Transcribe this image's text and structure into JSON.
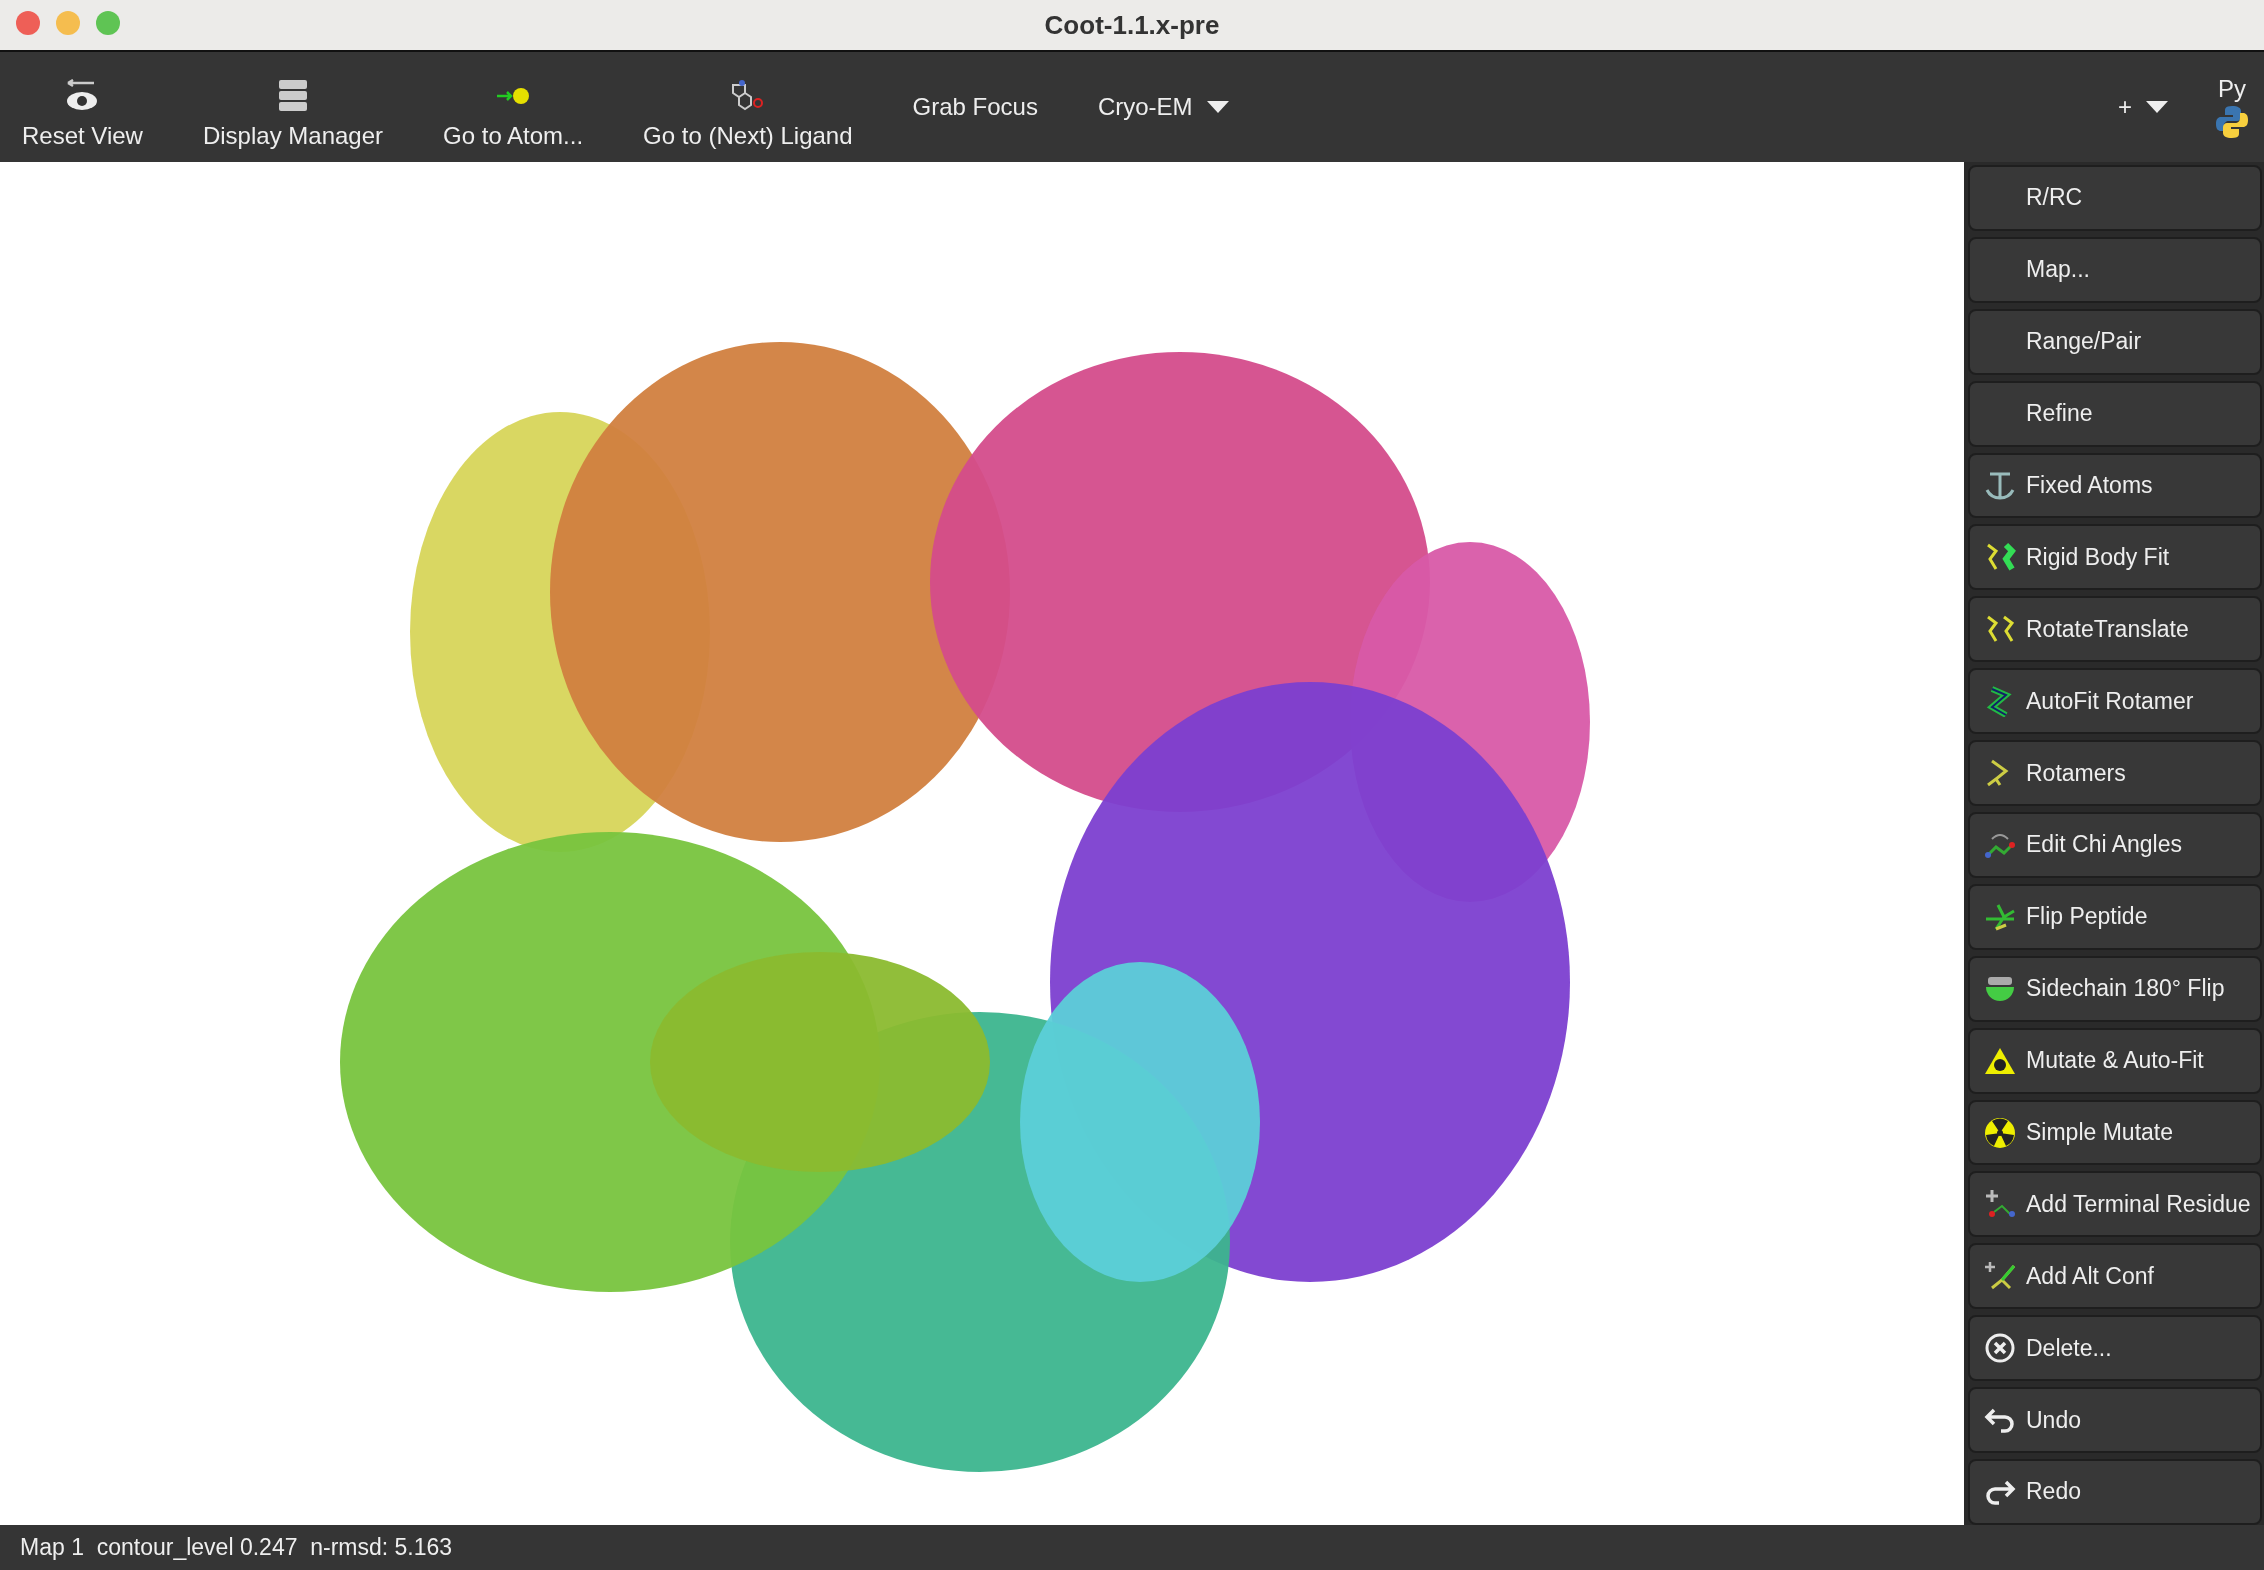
{
  "window": {
    "title": "Coot-1.1.x-pre"
  },
  "toolbar": {
    "items": [
      {
        "kind": "icon-button",
        "label": "Reset View"
      },
      {
        "kind": "icon-button",
        "label": "Display Manager"
      },
      {
        "kind": "icon-button",
        "label": "Go to Atom..."
      },
      {
        "kind": "icon-button",
        "label": "Go to (Next) Ligand"
      },
      {
        "kind": "text-button",
        "label": "Grab Focus"
      },
      {
        "kind": "dropdown",
        "label": "Cryo-EM"
      }
    ],
    "add_button": {
      "label": "+"
    },
    "python_button": {
      "label": "Py"
    }
  },
  "side_panel": {
    "buttons": [
      {
        "label": "R/RC"
      },
      {
        "label": "Map..."
      },
      {
        "label": "Range/Pair"
      },
      {
        "label": "Refine"
      },
      {
        "label": "Fixed Atoms"
      },
      {
        "label": "Rigid Body Fit"
      },
      {
        "label": "RotateTranslate"
      },
      {
        "label": "AutoFit Rotamer"
      },
      {
        "label": "Rotamers"
      },
      {
        "label": "Edit Chi Angles"
      },
      {
        "label": "Flip Peptide"
      },
      {
        "label": "Sidechain 180° Flip"
      },
      {
        "label": "Mutate & Auto-Fit"
      },
      {
        "label": "Simple Mutate"
      },
      {
        "label": "Add Terminal Residue"
      },
      {
        "label": "Add Alt Conf"
      },
      {
        "label": "Delete..."
      },
      {
        "label": "Undo"
      },
      {
        "label": "Redo"
      }
    ]
  },
  "status_bar": {
    "text": "Map 1  contour_level 0.247  n-rmsd: 5.163"
  }
}
